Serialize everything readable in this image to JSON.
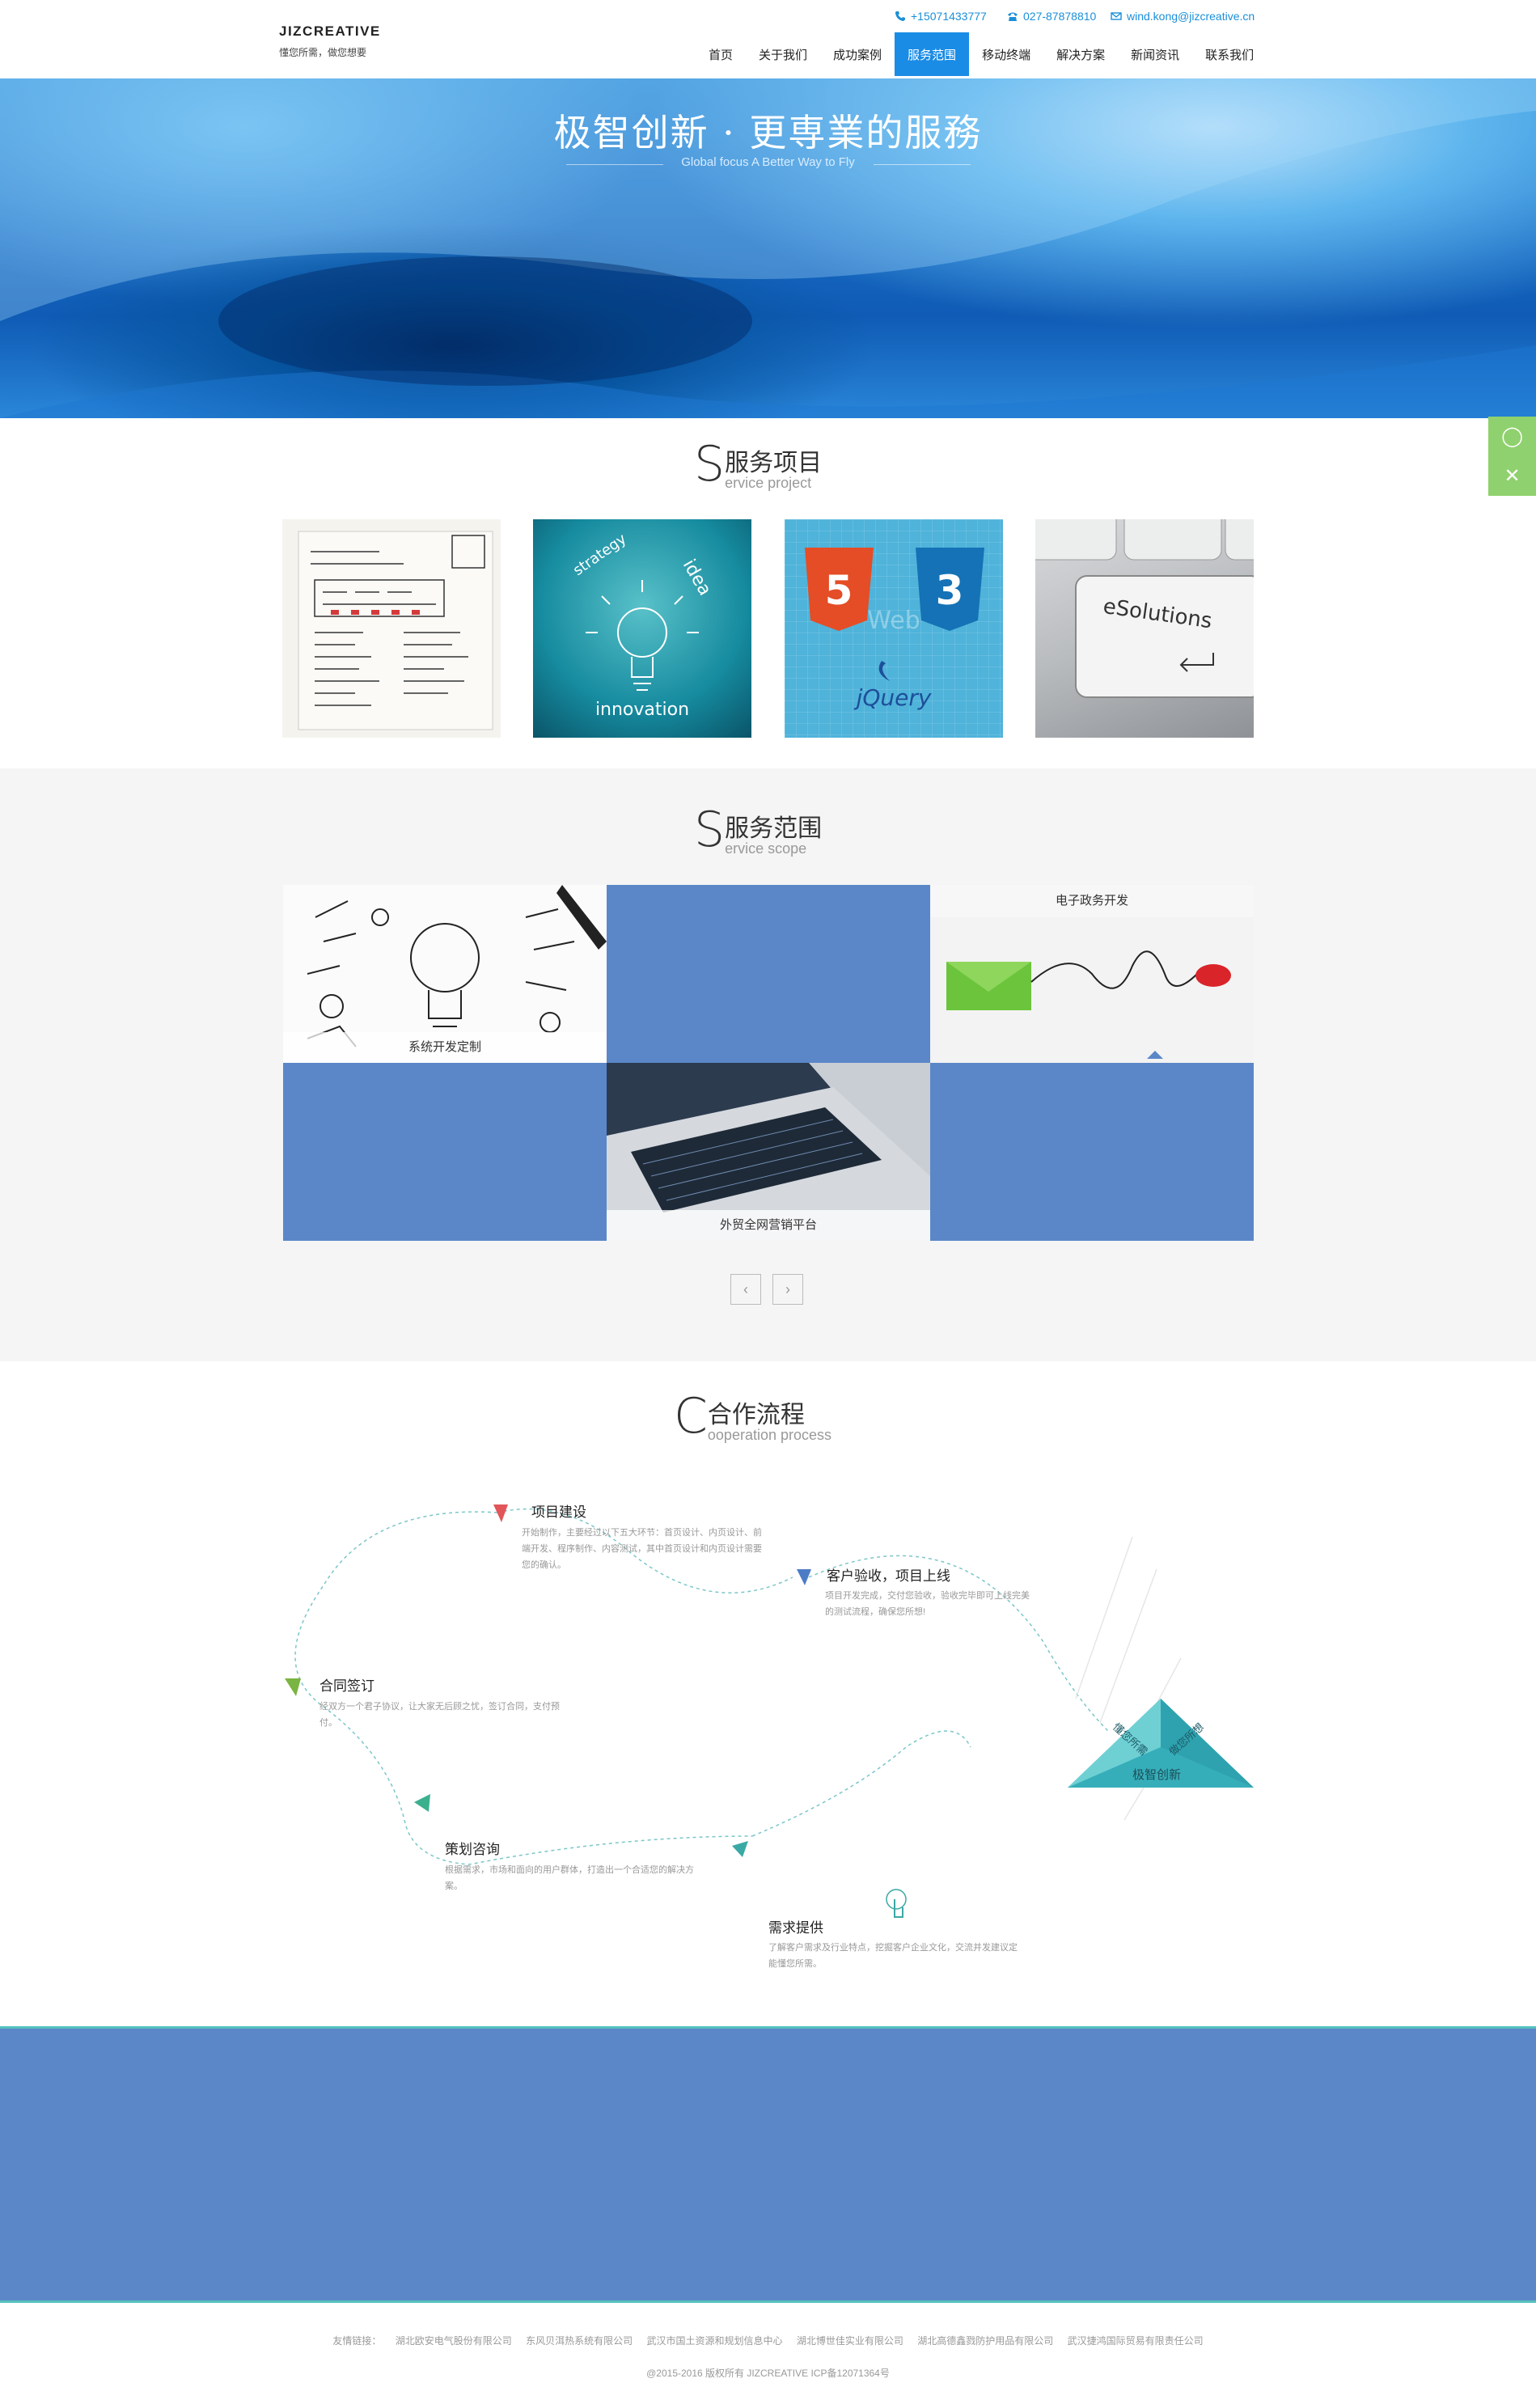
{
  "header": {
    "logo_title": "JIZCREATIVE",
    "logo_sub": "懂您所需，做您想要",
    "phone": "+15071433777",
    "tel": "027-87878810",
    "email": "wind.kong@jizcreative.cn",
    "nav": [
      "首页",
      "关于我们",
      "成功案例",
      "服务范围",
      "移动终端",
      "解决方案",
      "新闻资讯",
      "联系我们"
    ],
    "active_nav": "服务范围"
  },
  "banner": {
    "title": "极智创新 · 更専業的服務",
    "subtitle": "Global focus  A Better Way to Fly"
  },
  "service_project": {
    "letter": "S",
    "title_cn": "服务项目",
    "title_en": "ervice project",
    "tile_texts": {
      "strategy": "strategy",
      "idea": "idea",
      "innovation": "innovation",
      "html5": "5",
      "css3": "3",
      "web": "Web",
      "jquery": "jQuery",
      "key": "eSolutions"
    }
  },
  "service_scope": {
    "letter": "S",
    "title_cn": "服务范围",
    "title_en": "ervice scope",
    "cells": [
      "系统开发定制",
      "外贸全网营销平台",
      "电子政务开发"
    ],
    "prev": "‹",
    "next": "›"
  },
  "process": {
    "letter": "C",
    "title_cn": "合作流程",
    "title_en": "ooperation process",
    "steps": [
      {
        "title": "项目建设",
        "desc": "开始制作，主要经过以下五大环节：首页设计、内页设计、前端开发、程序制作、内容测试，其中首页设计和内页设计需要您的确认。"
      },
      {
        "title": "客户验收，项目上线",
        "desc": "项目开发完成，交付您验收，验收完毕即可上线完美的测试流程，确保您所想!"
      },
      {
        "title": "合同签订",
        "desc": "经双方一个君子协议，让大家无后顾之忧，签订合同，支付预付。"
      },
      {
        "title": "策划咨询",
        "desc": "根据需求，市场和面向的用户群体，打造出一个合适您的解决方案。"
      },
      {
        "title": "需求提供",
        "desc": "了解客户需求及行业特点，挖掘客户企业文化，交流并发建议定能懂您所需。"
      }
    ],
    "pyramid": {
      "left": "懂您所需",
      "right": "做您所想",
      "bottom": "极智创新"
    }
  },
  "footer": {
    "links_label": "友情链接：",
    "links": [
      "湖北欧安电气股份有限公司",
      "东风贝洱热系统有限公司",
      "武汉市国土资源和规划信息中心",
      "湖北博世佳实业有限公司",
      "湖北高德鑫戮防护用品有限公司",
      "武汉捷鸿国际贸易有限责任公司"
    ],
    "copyright": "@2015-2016 版权所有 JIZCREATIVE ICP备12071364号"
  },
  "colors": {
    "accent": "#1a8ce6",
    "scope_blue": "#5b87c8",
    "side_green": "#8fd16e",
    "band_border": "#56c1bd"
  }
}
